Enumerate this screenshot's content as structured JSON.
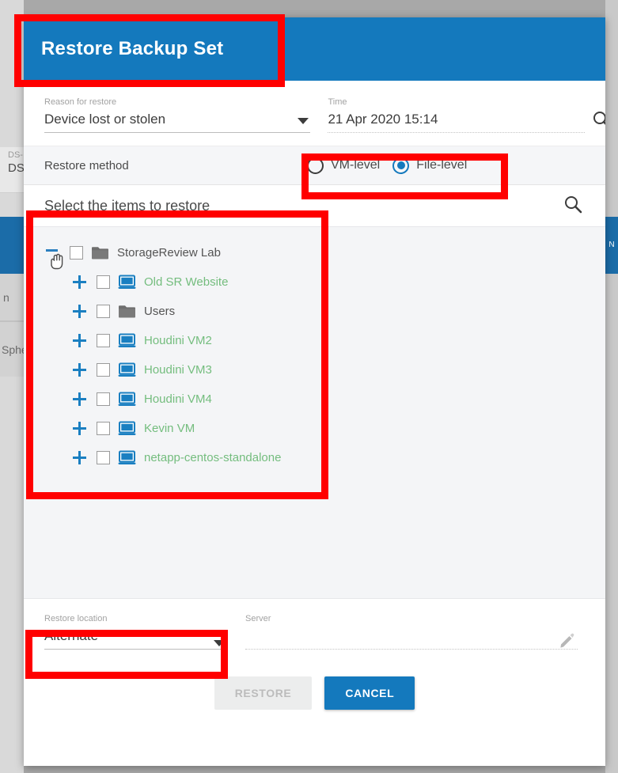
{
  "background": {
    "row_a_label": "DS-",
    "row_a_value": "DS",
    "row_b_text": "n",
    "row_c_text": "Sphe",
    "right_tab_text": "N"
  },
  "modal": {
    "title": "Restore Backup Set",
    "fields": {
      "reason": {
        "label": "Reason for restore",
        "value": "Device lost or stolen",
        "caret_icon": "chevron-down-icon"
      },
      "time": {
        "label": "Time",
        "value": "21 Apr 2020 15:14",
        "search_icon": "search-icon"
      }
    },
    "restore_method": {
      "label": "Restore method",
      "options": [
        {
          "label": "VM-level",
          "selected": false
        },
        {
          "label": "File-level",
          "selected": true
        }
      ]
    },
    "select_items": {
      "title": "Select the items to restore",
      "search_icon": "search-icon",
      "tree": [
        {
          "label": "StorageReview Lab",
          "icon": "folder-icon",
          "type": "folder",
          "level": 0,
          "expander": "minus",
          "checked": false,
          "cursor": true
        },
        {
          "label": "Old SR Website",
          "icon": "monitor-icon",
          "type": "vm",
          "level": 1,
          "expander": "plus",
          "checked": false,
          "cursor": false
        },
        {
          "label": "Users",
          "icon": "folder-icon",
          "type": "folder",
          "level": 1,
          "expander": "plus",
          "checked": false,
          "cursor": false
        },
        {
          "label": "Houdini VM2",
          "icon": "monitor-icon",
          "type": "vm",
          "level": 1,
          "expander": "plus",
          "checked": false,
          "cursor": false
        },
        {
          "label": "Houdini VM3",
          "icon": "monitor-icon",
          "type": "vm",
          "level": 1,
          "expander": "plus",
          "checked": false,
          "cursor": false
        },
        {
          "label": "Houdini VM4",
          "icon": "monitor-icon",
          "type": "vm",
          "level": 1,
          "expander": "plus",
          "checked": false,
          "cursor": false
        },
        {
          "label": "Kevin VM",
          "icon": "monitor-icon",
          "type": "vm",
          "level": 1,
          "expander": "plus",
          "checked": false,
          "cursor": false
        },
        {
          "label": "netapp-centos-standalone",
          "icon": "monitor-icon",
          "type": "vm",
          "level": 1,
          "expander": "plus",
          "checked": false,
          "cursor": false
        }
      ]
    },
    "restore_location": {
      "label": "Restore location",
      "value": "Alternate",
      "caret_icon": "chevron-down-icon"
    },
    "server": {
      "label": "Server",
      "value": "",
      "edit_icon": "pencil-icon"
    },
    "buttons": {
      "restore": "RESTORE",
      "cancel": "CANCEL"
    }
  },
  "colors": {
    "header_blue": "#1479bd",
    "accent_blue": "#1479bd",
    "vm_green": "#74bd7e",
    "folder_gray": "#6e6e6e",
    "annotation_red": "#ff0000",
    "panel_gray": "#f4f5f7"
  }
}
